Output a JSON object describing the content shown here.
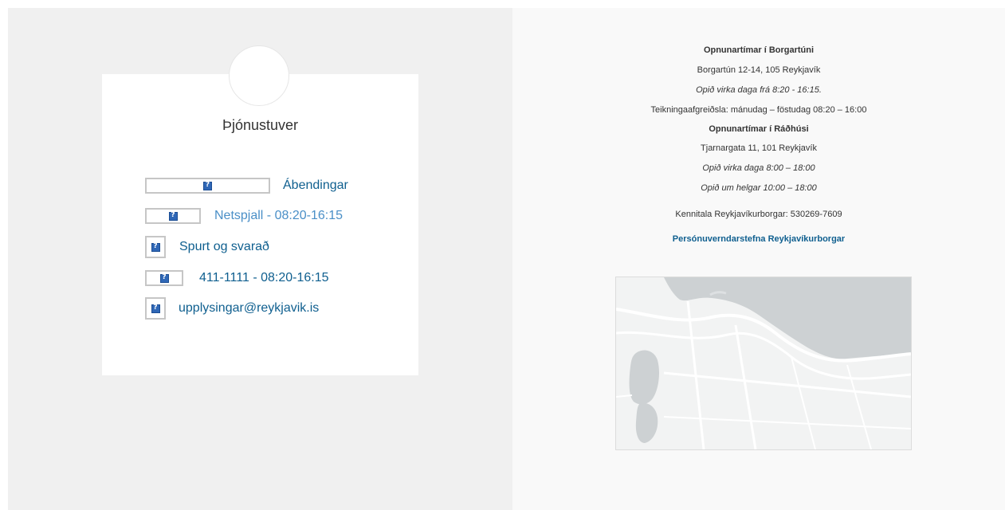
{
  "card": {
    "title": "Þjónustuver",
    "contacts": [
      {
        "label": "Ábendingar"
      },
      {
        "label": "Netspjall - 08:20-16:15"
      },
      {
        "label": "Spurt og svarað"
      },
      {
        "label": "411-1111 - 08:20-16:15"
      },
      {
        "label": "upplysingar@reykjavik.is"
      }
    ]
  },
  "info": {
    "borgartun_heading": "Opnunartímar í Borgartúni",
    "borgartun_address": "Borgartún 12-14, 105 Reykjavík",
    "borgartun_hours": "Opið virka daga frá 8:20 - 16:15.",
    "drawings_service": "Teikningaafgreiðsla: mánudag – föstudag 08:20 – 16:00",
    "radhus_heading": "Opnunartímar í Ráðhúsi",
    "radhus_address": "Tjarnargata 11, 101 Reykjavík",
    "radhus_weekday_hours": "Opið virka daga 8:00 – 18:00",
    "radhus_weekend_hours": "Opið um helgar 10:00  – 18:00",
    "kennitala": "Kennitala Reykjavíkurborgar: 530269-7609",
    "privacy_link": "Persónuverndarstefna Reykjavíkurborgar"
  },
  "icons": {
    "broken_image": "broken-image-icon"
  },
  "colors": {
    "link": "#0f5f8f",
    "link_light": "#4a8fc7",
    "left_background": "#f0f0f0",
    "right_background": "#f9f9f9",
    "text": "#333333"
  }
}
